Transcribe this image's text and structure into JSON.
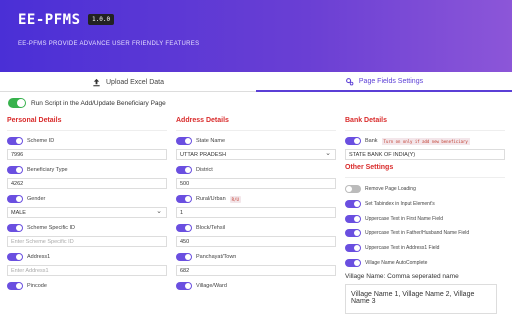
{
  "header": {
    "brand": "EE-PFMS",
    "version": "1.0.0",
    "tagline": "EE-PFMS PROVIDE ADVANCE USER FRIENDLY FEATURES",
    "gradient_start": "#4a2fd6",
    "gradient_end": "#8c56d8"
  },
  "tabs": [
    {
      "label": "Upload Excel Data",
      "icon": "upload-icon"
    },
    {
      "label": "Page Fields Settings",
      "icon": "gear-icon"
    }
  ],
  "run_script": {
    "label": "Run Script in the Add/Update Beneficiary Page",
    "enabled": true
  },
  "personal": {
    "title": "Personal Details",
    "scheme_id": {
      "label": "Scheme ID",
      "value": "7996"
    },
    "beneficiary_type": {
      "label": "Beneficiary Type",
      "value": "4262"
    },
    "gender": {
      "label": "Gender",
      "value": "MALE"
    },
    "scheme_specific_id": {
      "label": "Scheme Specific ID",
      "placeholder": "Enter Scheme Specific ID"
    },
    "address1": {
      "label": "Address1",
      "placeholder": "Enter Address1"
    },
    "pincode": {
      "label": "Pincode"
    }
  },
  "address": {
    "title": "Address Details",
    "state_name": {
      "label": "State Name",
      "value": "UTTAR PRADESH"
    },
    "district": {
      "label": "District",
      "value": "500"
    },
    "rural_urban": {
      "label": "Rural/Urban",
      "tag": "R/U",
      "value": "1"
    },
    "block_tehsil": {
      "label": "Block/Tehsil",
      "value": "450"
    },
    "panchayat_town": {
      "label": "Panchayat/Town",
      "value": "682"
    },
    "village_ward": {
      "label": "Village/Ward"
    }
  },
  "bank": {
    "title": "Bank Details",
    "bank": {
      "label": "Bank",
      "tag": "Turn on only if add new beneficiary",
      "value": "STATE BANK OF INDIA(Y)"
    }
  },
  "other": {
    "title": "Other Settings",
    "items": [
      {
        "label": "Remove Page Loading",
        "enabled": false
      },
      {
        "label": "Set Tabindex in Input Element's",
        "enabled": true
      },
      {
        "label": "Uppercase Text in First Name Field",
        "enabled": true
      },
      {
        "label": "Uppercase Text in Father/Husband Name Field",
        "enabled": true
      },
      {
        "label": "Uppercase Text in Address1 Field",
        "enabled": true
      },
      {
        "label": "Village Name AutoComplete",
        "enabled": true
      }
    ],
    "village_label": "Village Name: Comma seperated name",
    "village_value": "Village Name 1, Village Name 2, Village Name 3"
  }
}
